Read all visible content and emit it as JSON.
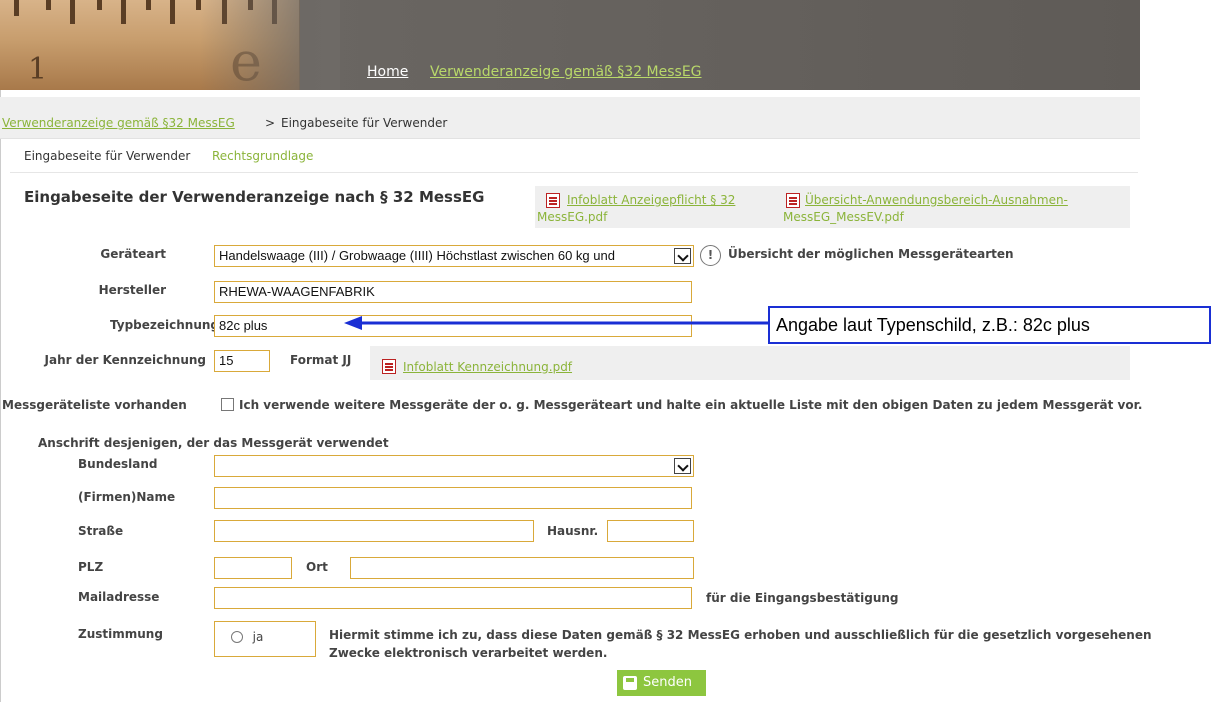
{
  "header": {
    "ruler_numerals": [
      "1",
      "e"
    ],
    "nav": {
      "home": "Home",
      "link": "Verwenderanzeige gemäß §32 MessEG"
    }
  },
  "breadcrumb": {
    "link": "Verwenderanzeige gemäß §32 MessEG",
    "separator": ">",
    "current": "Eingabeseite für Verwender"
  },
  "tabs": [
    "Eingabeseite für Verwender",
    "Rechtsgrundlage"
  ],
  "page_title": "Eingabeseite der Verwenderanzeige nach § 32 MessEG",
  "pdf_links": [
    {
      "line1": "Infoblatt Anzeigepflicht § 32",
      "line2": "MessEG.pdf"
    },
    {
      "line1": "Übersicht-Anwendungsbereich-Ausnahmen-",
      "line2": "MessEG_MessEV.pdf"
    }
  ],
  "form": {
    "geraeteart": {
      "label": "Geräteart",
      "value": "Handelswaage (III) / Grobwaage (IIII) Höchstlast zwischen 60 kg und",
      "info": "Übersicht der möglichen Messgerätearten"
    },
    "hersteller": {
      "label": "Hersteller",
      "value": "RHEWA-WAAGENFABRIK"
    },
    "typ": {
      "label": "Typbezeichnung",
      "value": "82c plus"
    },
    "jahr": {
      "label": "Jahr der Kennzeichnung",
      "value": "15",
      "format": "Format JJ",
      "pdf": "Infoblatt Kennzeichnung.pdf"
    },
    "liste": {
      "label": "Messgeräteliste vorhanden",
      "text": "Ich verwende weitere Messgeräte der o. g. Messgeräteart und halte ein aktuelle Liste mit den obigen Daten zu jedem Messgerät vor.",
      "checked": false
    },
    "anschrift_heading": "Anschrift desjenigen, der das Messgerät verwendet",
    "bundesland": {
      "label": "Bundesland",
      "value": ""
    },
    "firma": {
      "label": "(Firmen)Name",
      "value": ""
    },
    "strasse": {
      "label": "Straße",
      "value": ""
    },
    "hausnr": {
      "label": "Hausnr.",
      "value": ""
    },
    "plz": {
      "label": "PLZ",
      "value": ""
    },
    "ort": {
      "label": "Ort",
      "value": ""
    },
    "mail": {
      "label": "Mailadresse",
      "value": "",
      "hint": "für die Eingangsbestätigung"
    },
    "zustimmung": {
      "label": "Zustimmung",
      "option": "ja",
      "selected": false,
      "text_line1": "Hiermit stimme ich zu, dass diese Daten gemäß § 32 MessEG erhoben und ausschließlich für die gesetzlich vorgesehenen",
      "text_line2": "Zwecke elektronisch verarbeitet werden."
    },
    "submit": "Senden"
  },
  "annotation": {
    "callout": "Angabe laut Typenschild, z.B.: 82c plus",
    "arrow_color": "#1a2fd4"
  },
  "colors": {
    "accent_green": "#8bb43a",
    "field_border": "#d9a93a",
    "button": "#8dc63f",
    "header": "#6e6a66"
  }
}
